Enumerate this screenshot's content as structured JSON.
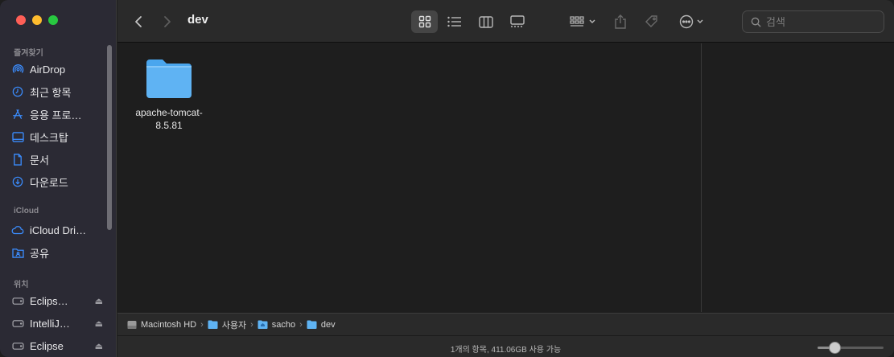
{
  "window": {
    "title": "dev"
  },
  "sidebar": {
    "sections": {
      "favorites": "즐겨찾기",
      "icloud": "iCloud",
      "locations": "위치"
    },
    "favorites": [
      {
        "label": "AirDrop",
        "icon": "airdrop-icon"
      },
      {
        "label": "최근 항목",
        "icon": "clock-icon"
      },
      {
        "label": "응용 프로…",
        "icon": "applications-icon"
      },
      {
        "label": "데스크탑",
        "icon": "desktop-icon"
      },
      {
        "label": "문서",
        "icon": "document-icon"
      },
      {
        "label": "다운로드",
        "icon": "download-icon"
      }
    ],
    "icloud": [
      {
        "label": "iCloud Dri…",
        "icon": "cloud-icon"
      },
      {
        "label": "공유",
        "icon": "shared-folder-icon"
      }
    ],
    "locations": [
      {
        "label": "Eclips…",
        "icon": "disk-icon",
        "eject": "⏏"
      },
      {
        "label": "IntelliJ…",
        "icon": "disk-icon",
        "eject": "⏏"
      },
      {
        "label": "Eclipse",
        "icon": "disk-icon",
        "eject": "⏏"
      }
    ]
  },
  "toolbar": {
    "search_placeholder": "검색",
    "active_view": "icon"
  },
  "content": {
    "items": [
      {
        "name": "apache-tomcat-8.5.81",
        "kind": "folder"
      }
    ]
  },
  "pathbar": {
    "crumbs": [
      "Macintosh HD",
      "사용자",
      "sacho",
      "dev"
    ],
    "separator": "›"
  },
  "status": {
    "text": "1개의 항목, 411.06GB 사용 가능",
    "zoom_level": 0.25
  },
  "colors": {
    "accent": "#2f8cff",
    "folder": "#5fb3f3"
  }
}
